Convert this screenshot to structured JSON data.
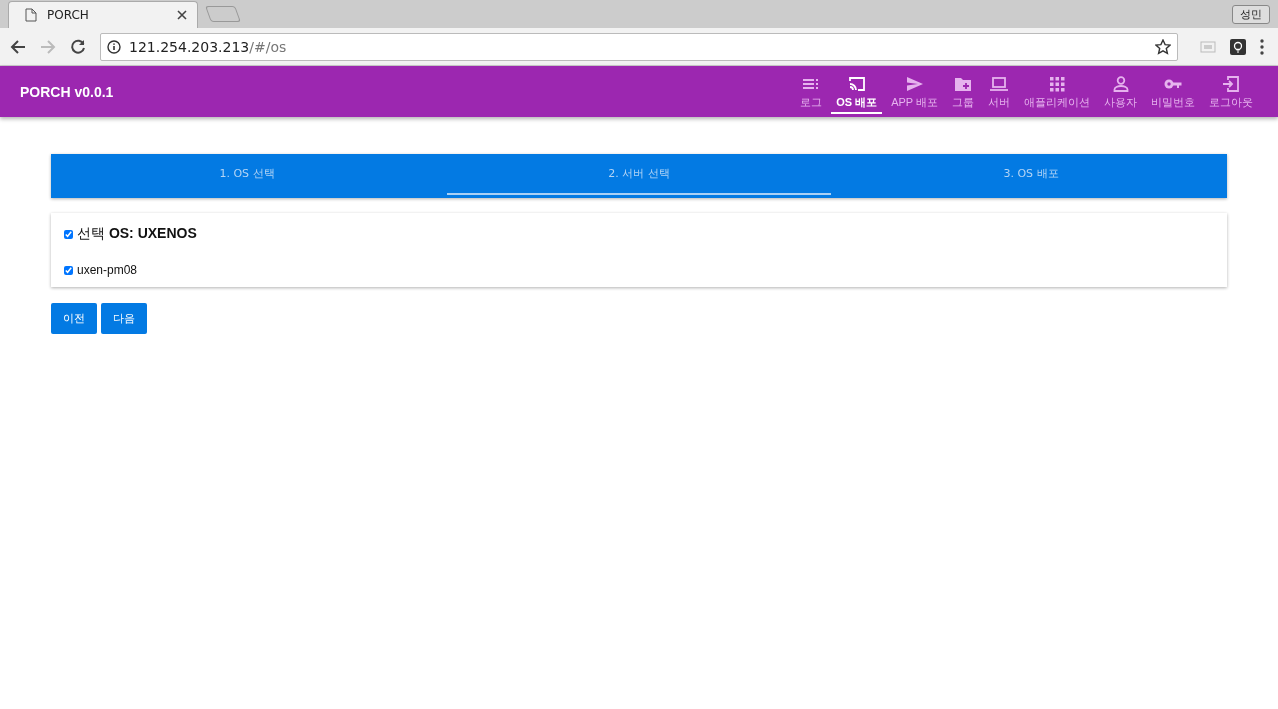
{
  "browser": {
    "tab_title": "PORCH",
    "profile": "성민",
    "url_host": "121.254.203.213",
    "url_path": "/#/os"
  },
  "app": {
    "title": "PORCH v0.0.1",
    "nav": [
      {
        "label": "로그",
        "kind": "list",
        "selected": false
      },
      {
        "label": "OS 배포",
        "kind": "cast",
        "selected": true
      },
      {
        "label": "APP 배포",
        "kind": "send",
        "selected": false
      },
      {
        "label": "그룹",
        "kind": "folder",
        "selected": false
      },
      {
        "label": "서버",
        "kind": "laptop",
        "selected": false
      },
      {
        "label": "애플리케이션",
        "kind": "grid",
        "selected": false
      },
      {
        "label": "사용자",
        "kind": "person",
        "selected": false
      },
      {
        "label": "비밀번호",
        "kind": "key",
        "selected": false
      },
      {
        "label": "로그아웃",
        "kind": "exit",
        "selected": false
      }
    ]
  },
  "steps": [
    {
      "label": "1. OS 선택",
      "selected": false
    },
    {
      "label": "2. 서버 선택",
      "selected": true
    },
    {
      "label": "3. OS 배포",
      "selected": false
    }
  ],
  "selection": [
    {
      "kind": "heading",
      "label": "선택 **OS: UXENOS**",
      "checked": true
    },
    {
      "kind": "item",
      "label": "uxen-pm08",
      "checked": true
    }
  ],
  "buttons": [
    "이전",
    "다음"
  ]
}
